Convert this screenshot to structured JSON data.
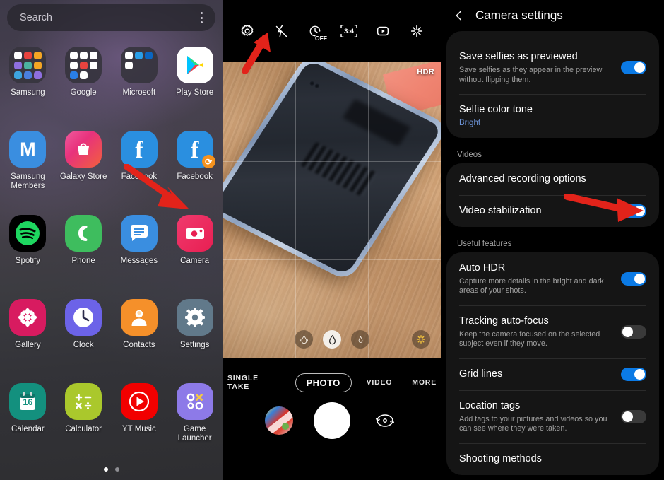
{
  "launcher": {
    "search": {
      "placeholder": "Search",
      "value": "Search"
    },
    "overflow_icon": "kebab-menu-icon",
    "apps": [
      {
        "label": "Samsung",
        "type": "folder",
        "colors": [
          "#ffffff",
          "#e8433f",
          "#f5a623",
          "#8e6fe0",
          "#4bb3a0",
          "#f5a623",
          "#3da5e0",
          "#4a7fe0",
          "#8e6fe0"
        ]
      },
      {
        "label": "Google",
        "type": "folder",
        "colors": [
          "#ffffff",
          "#ffffff",
          "#ffffff",
          "#ffffff",
          "#e8433f",
          "#ffffff",
          "#2a7fe8",
          "#ffffff",
          "#ffffff"
        ]
      },
      {
        "label": "Microsoft",
        "type": "folder",
        "colors": [
          "#ffffff",
          "#2a9fe8",
          "#0a66c2",
          "#ffffff"
        ]
      },
      {
        "label": "Play Store",
        "type": "app",
        "icon": "play-store-icon"
      },
      {
        "label": "Samsung Members",
        "type": "app",
        "icon": "samsung-members-icon"
      },
      {
        "label": "Galaxy Store",
        "type": "app",
        "icon": "galaxy-store-icon"
      },
      {
        "label": "Facebook",
        "type": "app",
        "icon": "facebook-icon"
      },
      {
        "label": "Facebook",
        "type": "app",
        "icon": "facebook-lite-icon"
      },
      {
        "label": "Spotify",
        "type": "app",
        "icon": "spotify-icon"
      },
      {
        "label": "Phone",
        "type": "app",
        "icon": "phone-icon"
      },
      {
        "label": "Messages",
        "type": "app",
        "icon": "messages-icon"
      },
      {
        "label": "Camera",
        "type": "app",
        "icon": "camera-icon"
      },
      {
        "label": "Gallery",
        "type": "app",
        "icon": "gallery-icon"
      },
      {
        "label": "Clock",
        "type": "app",
        "icon": "clock-icon"
      },
      {
        "label": "Contacts",
        "type": "app",
        "icon": "contacts-icon"
      },
      {
        "label": "Settings",
        "type": "app",
        "icon": "settings-gear-icon"
      },
      {
        "label": "Calendar",
        "type": "app",
        "icon": "calendar-icon",
        "day": "16"
      },
      {
        "label": "Calculator",
        "type": "app",
        "icon": "calculator-icon"
      },
      {
        "label": "YT Music",
        "type": "app",
        "icon": "yt-music-icon"
      },
      {
        "label": "Game Launcher",
        "type": "app",
        "icon": "game-launcher-icon"
      }
    ],
    "page_dots": {
      "count": 2,
      "active_index": 0
    },
    "annotation_arrow": "red-arrow-pointing-to-camera-app"
  },
  "camera": {
    "toolbar": [
      {
        "name": "settings-gear-icon",
        "label": "Settings"
      },
      {
        "name": "flash-off-icon",
        "label": "Flash off"
      },
      {
        "name": "timer-off-icon",
        "label": "OFF"
      },
      {
        "name": "aspect-ratio-icon",
        "label": "3:4"
      },
      {
        "name": "motion-photo-icon",
        "label": "Motion photo"
      },
      {
        "name": "filters-icon",
        "label": "Filters"
      }
    ],
    "timer_label": "OFF",
    "aspect_label": "3:4",
    "hdr_badge": "HDR",
    "lens_buttons": [
      {
        "name": "ultrawide-lens-button",
        "selected": false
      },
      {
        "name": "wide-lens-button",
        "selected": true
      },
      {
        "name": "tele-lens-button",
        "selected": false
      }
    ],
    "scene_optimizer": "scene-optimizer-button",
    "modes": [
      {
        "label": "SINGLE TAKE",
        "active": false
      },
      {
        "label": "PHOTO",
        "active": true
      },
      {
        "label": "VIDEO",
        "active": false
      },
      {
        "label": "MORE",
        "active": false
      }
    ],
    "gallery_thumbnail": "last-photo-thumbnail",
    "shutter": "shutter-button",
    "flip": "flip-camera-button",
    "annotation_arrow": "red-arrow-pointing-to-settings-gear"
  },
  "settings": {
    "header": {
      "back_icon": "back-chevron-icon",
      "title": "Camera settings"
    },
    "groups": [
      {
        "section": "",
        "rows": [
          {
            "title": "Save selfies as previewed",
            "sub": "Save selfies as they appear in the preview without flipping them.",
            "control": "toggle",
            "on": true
          },
          {
            "title": "Selfie color tone",
            "sub": "Bright",
            "sub_accent": true,
            "control": "none"
          }
        ]
      },
      {
        "section": "Videos",
        "rows": [
          {
            "title": "Advanced recording options",
            "sub": "",
            "control": "none"
          },
          {
            "title": "Video stabilization",
            "sub": "",
            "control": "toggle",
            "on": true
          }
        ]
      },
      {
        "section": "Useful features",
        "rows": [
          {
            "title": "Auto HDR",
            "sub": "Capture more details in the bright and dark areas of your shots.",
            "control": "toggle",
            "on": true
          },
          {
            "title": "Tracking auto-focus",
            "sub": "Keep the camera focused on the selected subject even if they move.",
            "control": "toggle",
            "on": false
          },
          {
            "title": "Grid lines",
            "sub": "",
            "control": "toggle",
            "on": true
          },
          {
            "title": "Location tags",
            "sub": "Add tags to your pictures and videos so you can see where they were taken.",
            "control": "toggle",
            "on": false
          },
          {
            "title": "Shooting methods",
            "sub": "",
            "control": "none"
          }
        ]
      }
    ],
    "annotation_arrow": "red-arrow-pointing-to-video-stabilization-toggle"
  },
  "colors": {
    "toggle_on": "#0b7ae5",
    "accent_text": "#6d94d8",
    "arrow_red": "#e2231a",
    "card_bg": "#151515"
  }
}
